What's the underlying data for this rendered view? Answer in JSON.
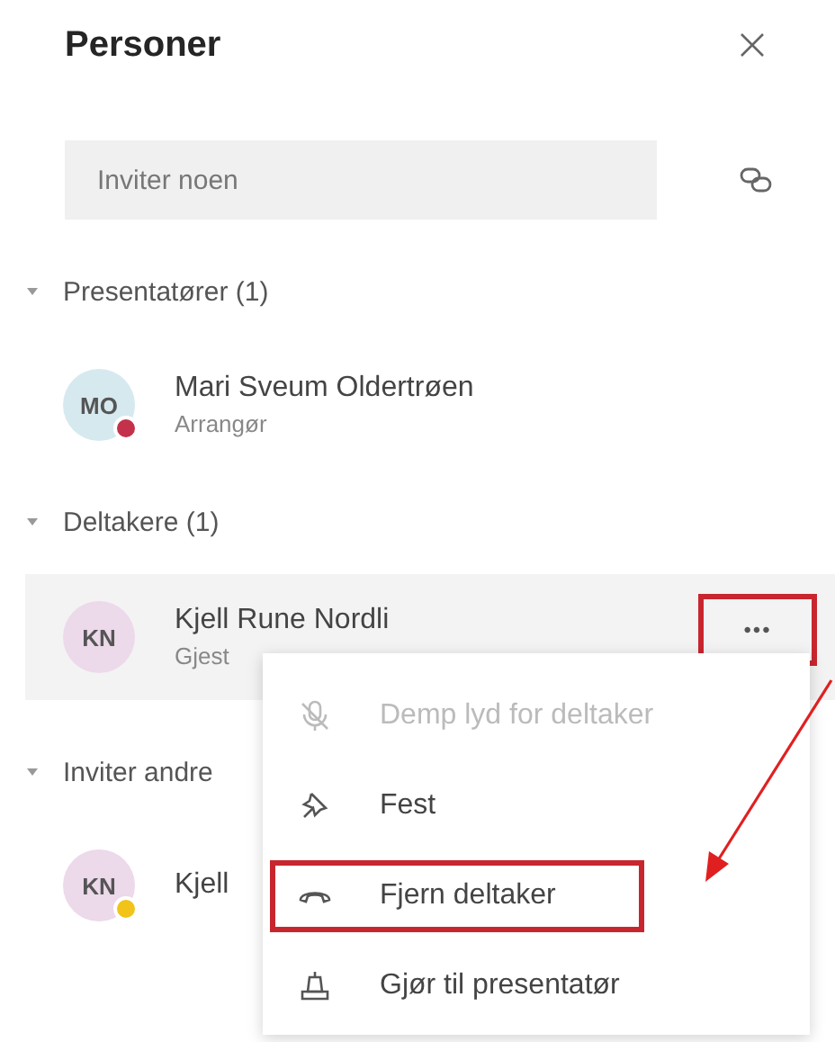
{
  "panel": {
    "title": "Personer",
    "invite": {
      "placeholder": "Inviter noen"
    },
    "sections": [
      {
        "title": "Presentatører (1)",
        "expanded": true,
        "people": [
          {
            "avatar": {
              "initials": "MO",
              "color": "#d6e9ef"
            },
            "name": "Mari Sveum Oldertrøen",
            "role": "Arrangør",
            "presence": {
              "color": "#c4314b"
            },
            "hovered": false
          }
        ]
      },
      {
        "title": "Deltakere (1)",
        "expanded": true,
        "people": [
          {
            "avatar": {
              "initials": "KN",
              "color": "#ecd9ea"
            },
            "name": "Kjell Rune Nordli",
            "role": "Gjest",
            "hovered": true,
            "more": {
              "label": "•••",
              "highlighted": true
            }
          }
        ]
      },
      {
        "title": "Inviter andre",
        "expanded": true,
        "people": [
          {
            "avatar": {
              "initials": "KN",
              "color": "#ecd9ea"
            },
            "name": "Kjell",
            "presence": {
              "color": "#f2c318"
            },
            "hovered": false
          }
        ]
      }
    ]
  },
  "menu": {
    "items": [
      {
        "kind": "mute",
        "label": "Demp lyd for deltaker",
        "disabled": true,
        "highlighted": false
      },
      {
        "kind": "pin",
        "label": "Fest",
        "disabled": false,
        "highlighted": false
      },
      {
        "kind": "hangup",
        "label": "Fjern deltaker",
        "disabled": false,
        "highlighted": true
      },
      {
        "kind": "presenter",
        "label": "Gjør til presentatør",
        "disabled": false,
        "highlighted": false
      }
    ],
    "annotation_arrow": true
  }
}
